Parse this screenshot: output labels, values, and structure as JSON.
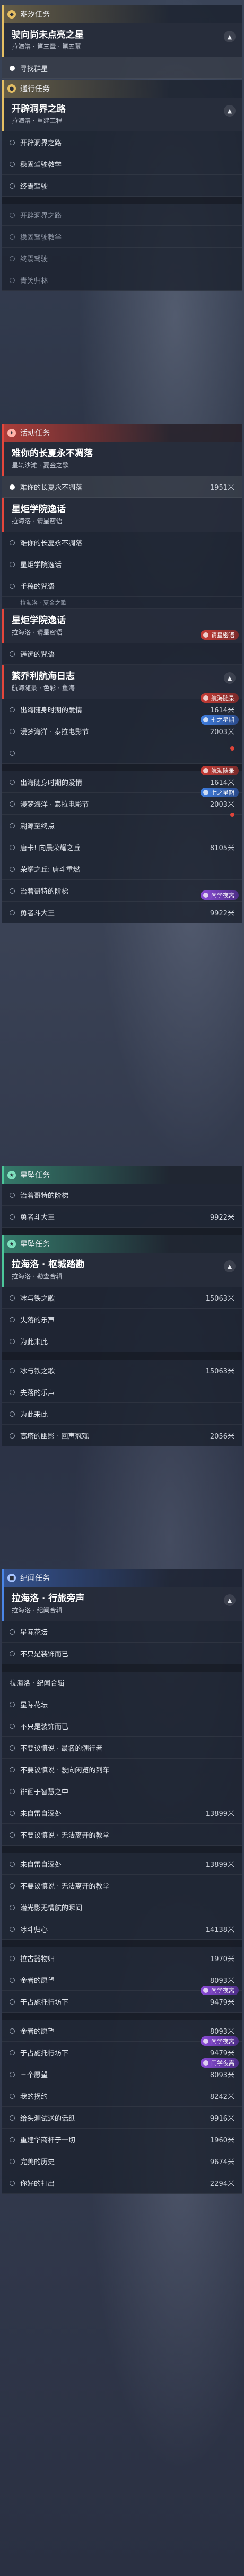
{
  "sections": {
    "tidal": "潮汐任务",
    "mission": "通行任务",
    "event": "活动任务",
    "starfall": "星坠任务",
    "travelogue": "纪闻任务"
  },
  "q1": {
    "title": "驶向尚未点亮之星",
    "sub": "拉海洛 · 第三章 · 第五幕",
    "steps": [
      "寻找群星"
    ]
  },
  "q2": {
    "title": "开辟洞界之路",
    "sub": "拉海洛 · 重建工程",
    "steps": [
      "开辟洞界之路",
      "稳固驾驶教学",
      "终焉驾驶",
      "开辟洞界之路",
      "稳固驾驶教学",
      "终焉驾驶",
      "青笑归林"
    ]
  },
  "q3": {
    "title": "难你的长夏永不凋落",
    "sub": "星轨沙滩 · 夏金之歌",
    "steps": [
      {
        "t": "难你的长夏永不凋落",
        "d": "1951米"
      }
    ]
  },
  "q4": {
    "title": "星炬学院逸话",
    "sub": "拉海洛 · 请星密语",
    "steps": [
      "难你的长夏永不凋落",
      "星炬学院逸话",
      "手稿的咒语",
      "遥远的咒语"
    ],
    "frag": "拉海洛 · 夏金之歌",
    "tag": "请星密语"
  },
  "q5": {
    "title": "繁乔利航海日志",
    "sub": "航海随录 · 色彩 · 鱼海",
    "steps": [
      {
        "t": "出海随身时期的爱情",
        "d": "1614米"
      },
      {
        "t": "漫梦海洋 · 泰拉电影节",
        "d": "2003米"
      },
      {
        "t": "",
        "d": ""
      },
      {
        "t": "出海随身时期的爱情",
        "d": "1614米"
      },
      {
        "t": "漫梦海洋 · 泰拉电影节",
        "d": "2003米"
      },
      {
        "t": "溯源至终点",
        "d": ""
      },
      {
        "t": "唐卡! 向晨荣耀之丘",
        "d": "8105米"
      },
      {
        "t": "荣耀之丘: 唐斗重燃",
        "d": ""
      },
      {
        "t": "治着哥特的阶梯",
        "d": ""
      },
      {
        "t": "勇者斗大王",
        "d": "9922米"
      },
      {
        "t": "治着哥特的阶梯",
        "d": ""
      },
      {
        "t": "勇者斗大王",
        "d": "9922米"
      }
    ],
    "tags": {
      "red": "航海随录",
      "blue": "七之星期",
      "purple": "闹学夜离"
    }
  },
  "q6": {
    "title": "拉海洛 · 枢城踏勘",
    "sub": "拉海洛 · 勘查合辑",
    "steps": [
      {
        "t": "冰与铁之歌",
        "d": "15063米"
      },
      {
        "t": "失落的乐声",
        "d": ""
      },
      {
        "t": "为此来此",
        "d": ""
      },
      {
        "t": "冰与铁之歌",
        "d": "15063米"
      },
      {
        "t": "失落的乐声",
        "d": ""
      },
      {
        "t": "为此来此",
        "d": ""
      },
      {
        "t": "高塔的幽影 · 回声冠观",
        "d": "2056米"
      }
    ]
  },
  "q7": {
    "title": "拉海洛 · 行旅旁声",
    "sub": "拉海洛 · 纪闻合辑",
    "steps": [
      {
        "t": "星际花坛",
        "d": ""
      },
      {
        "t": "不只是装饰而已",
        "d": ""
      },
      {
        "t": "拉海洛 · 纪闻合辑",
        "d": ""
      },
      {
        "t": "星际花坛",
        "d": ""
      },
      {
        "t": "不只是装饰而已",
        "d": ""
      },
      {
        "t": "不要议慎说 · 最名的潮行者",
        "d": ""
      },
      {
        "t": "不要议慎说 · 驶向闲览的列车",
        "d": ""
      },
      {
        "t": "徘徊于智慧之中",
        "d": ""
      },
      {
        "t": "未自雷自深处",
        "d": "13899米"
      },
      {
        "t": "不要议慎说 · 无法离开的教堂",
        "d": ""
      },
      {
        "t": "未自雷自深处",
        "d": "13899米"
      },
      {
        "t": "不要议慎说 · 无法离开的教堂",
        "d": ""
      },
      {
        "t": "潜光影无情航的瞬间",
        "d": ""
      },
      {
        "t": "冰斗归心",
        "d": "14138米"
      },
      {
        "t": "拉古器物归",
        "d": "1970米"
      },
      {
        "t": "金者的愿望",
        "d": "8093米"
      },
      {
        "t": "于占施托行坊下",
        "d": "9479米"
      },
      {
        "t": "金者的愿望",
        "d": "8093米"
      },
      {
        "t": "于占施托行坊下",
        "d": "9479米"
      },
      {
        "t": "三个愿望",
        "d": "8093米"
      },
      {
        "t": "我的拐约",
        "d": "8242米"
      },
      {
        "t": "给头测试送的话纸",
        "d": "9916米"
      },
      {
        "t": "重建华商杆于一切",
        "d": "1960米"
      },
      {
        "t": "完美的历史",
        "d": "9674米"
      },
      {
        "t": "你好的打出",
        "d": "2294米"
      }
    ],
    "tag": "闹学夜离"
  }
}
